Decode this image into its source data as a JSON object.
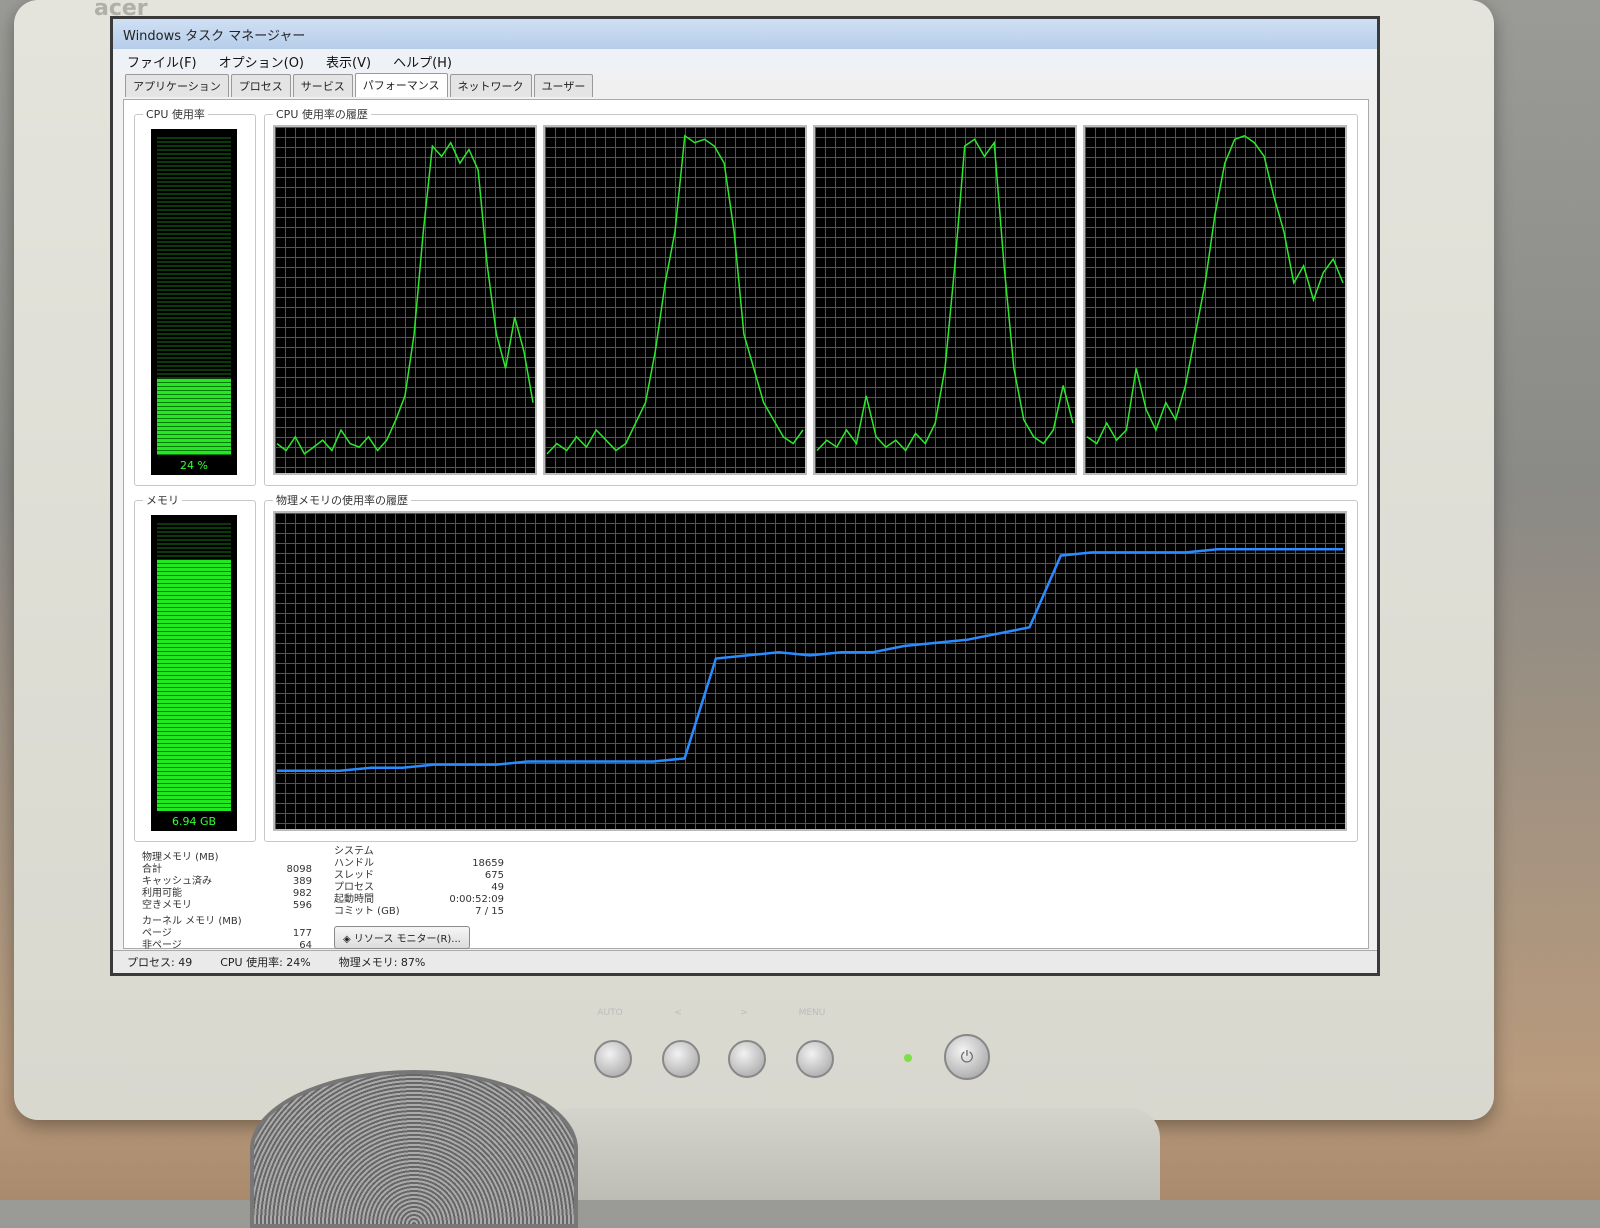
{
  "window": {
    "title": "Windows タスク マネージャー"
  },
  "menu": [
    "ファイル(F)",
    "オプション(O)",
    "表示(V)",
    "ヘルプ(H)"
  ],
  "tabs": [
    "アプリケーション",
    "プロセス",
    "サービス",
    "パフォーマンス",
    "ネットワーク",
    "ユーザー"
  ],
  "active_tab": 3,
  "cpu": {
    "group_label": "CPU 使用率",
    "value": "24 %",
    "fill": 0.24,
    "history_label": "CPU 使用率の履歴"
  },
  "memory": {
    "group_label": "メモリ",
    "value": "6.94 GB",
    "fill": 0.87,
    "history_label": "物理メモリの使用率の履歴"
  },
  "physical_memory": {
    "header": "物理メモリ (MB)",
    "rows": [
      {
        "label": "合計",
        "value": "8098"
      },
      {
        "label": "キャッシュ済み",
        "value": "389"
      },
      {
        "label": "利用可能",
        "value": "982"
      },
      {
        "label": "空きメモリ",
        "value": "596"
      }
    ]
  },
  "kernel_memory": {
    "header": "カーネル メモリ (MB)",
    "rows": [
      {
        "label": "ページ",
        "value": "177"
      },
      {
        "label": "非ページ",
        "value": "64"
      }
    ]
  },
  "system": {
    "header": "システム",
    "rows": [
      {
        "label": "ハンドル",
        "value": "18659"
      },
      {
        "label": "スレッド",
        "value": "675"
      },
      {
        "label": "プロセス",
        "value": "49"
      },
      {
        "label": "起動時間",
        "value": "0:00:52:09"
      },
      {
        "label": "コミット (GB)",
        "value": "7 / 15"
      }
    ]
  },
  "resource_monitor_button": "リソース モニター(R)...",
  "status": {
    "processes": "プロセス: 49",
    "cpu": "CPU 使用率: 24%",
    "memory": "物理メモリ: 87%"
  },
  "bezel": {
    "labels": [
      "AUTO",
      "<",
      ">",
      "MENU"
    ]
  },
  "colors": {
    "cpu_line": "#2ee82e",
    "memory_line": "#2a8cff",
    "grid": "#0b7a4c"
  },
  "chart_data": [
    {
      "type": "line",
      "title": "CPU 使用率の履歴",
      "series": [
        {
          "values": [
            8,
            6,
            10,
            5,
            7,
            9,
            6,
            12,
            8,
            7,
            10,
            6,
            9,
            15,
            22,
            40,
            70,
            95,
            92,
            96,
            90,
            94,
            88,
            60,
            40,
            30,
            45,
            35,
            20
          ]
        }
      ],
      "ylim": [
        0,
        100
      ]
    },
    {
      "type": "line",
      "series": [
        {
          "values": [
            5,
            8,
            6,
            10,
            7,
            12,
            9,
            6,
            8,
            14,
            20,
            35,
            55,
            70,
            98,
            96,
            97,
            95,
            90,
            70,
            40,
            30,
            20,
            15,
            10,
            8,
            12
          ]
        }
      ],
      "ylim": [
        0,
        100
      ]
    },
    {
      "type": "line",
      "series": [
        {
          "values": [
            6,
            9,
            7,
            12,
            8,
            22,
            10,
            7,
            9,
            6,
            11,
            8,
            14,
            30,
            60,
            95,
            97,
            92,
            96,
            60,
            30,
            15,
            10,
            8,
            12,
            25,
            14
          ]
        }
      ],
      "ylim": [
        0,
        100
      ]
    },
    {
      "type": "line",
      "series": [
        {
          "values": [
            10,
            8,
            14,
            9,
            12,
            30,
            18,
            12,
            20,
            15,
            25,
            40,
            55,
            75,
            90,
            97,
            98,
            96,
            92,
            80,
            70,
            55,
            60,
            50,
            58,
            62,
            55
          ]
        }
      ],
      "ylim": [
        0,
        100
      ]
    },
    {
      "type": "line",
      "title": "物理メモリの使用率の履歴",
      "series": [
        {
          "values": [
            18,
            18,
            18,
            19,
            19,
            20,
            20,
            20,
            21,
            21,
            21,
            21,
            21,
            22,
            54,
            55,
            56,
            55,
            56,
            56,
            58,
            59,
            60,
            62,
            64,
            87,
            88,
            88,
            88,
            88,
            89,
            89,
            89,
            89,
            89
          ]
        }
      ],
      "ylim": [
        0,
        100
      ]
    }
  ]
}
